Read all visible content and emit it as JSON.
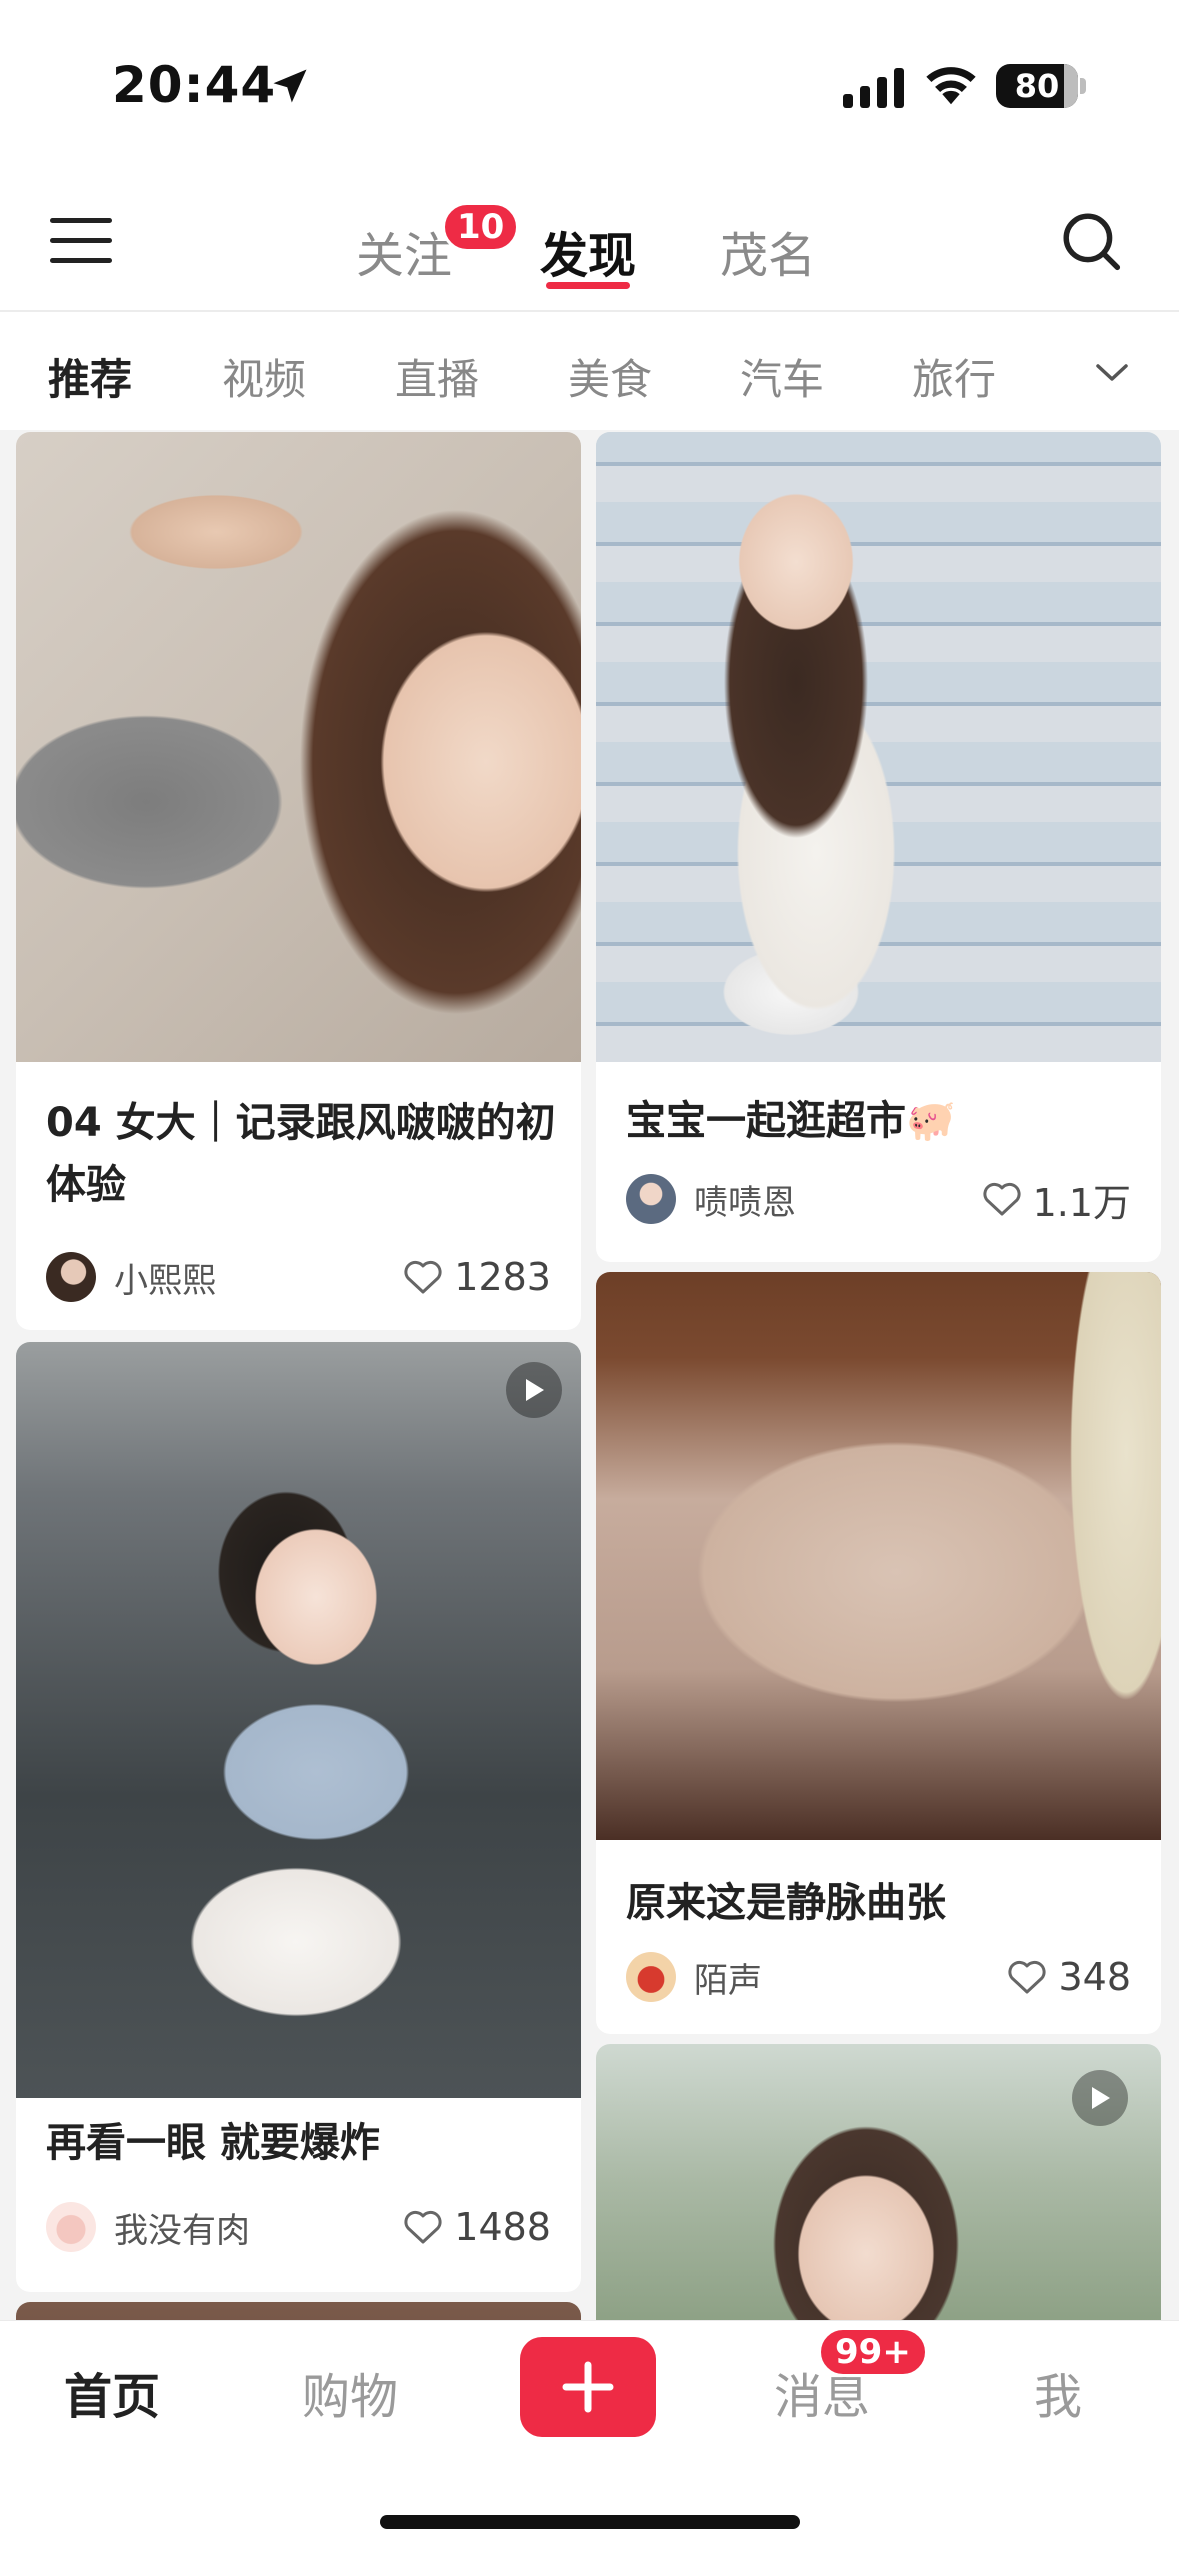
{
  "status": {
    "time": "20:44",
    "battery": "80"
  },
  "nav": {
    "tabs": [
      "关注",
      "发现",
      "茂名"
    ],
    "active_tab": "发现",
    "follow_badge": "10"
  },
  "categories": [
    "推荐",
    "视频",
    "直播",
    "美食",
    "汽车",
    "旅行"
  ],
  "feed": {
    "left": [
      {
        "title": "04 女大｜记录跟风啵啵的初体验",
        "author": "小熙熙",
        "likes": "1283",
        "video": false
      },
      {
        "title": "再看一眼 就要爆炸",
        "author": "我没有肉",
        "likes": "1488",
        "video": true
      }
    ],
    "right": [
      {
        "title": "宝宝一起逛超市🐖",
        "author": "啧啧恩",
        "likes": "1.1万",
        "video": false
      },
      {
        "title": "原来这是静脉曲张",
        "author": "陌声",
        "likes": "348",
        "video": false
      },
      {
        "title": "",
        "author": "",
        "likes": "",
        "video": true
      }
    ]
  },
  "tabbar": {
    "home": "首页",
    "shop": "购物",
    "messages": "消息",
    "messages_badge": "99+",
    "me": "我"
  },
  "colors": {
    "accent": "#ee2b45"
  }
}
